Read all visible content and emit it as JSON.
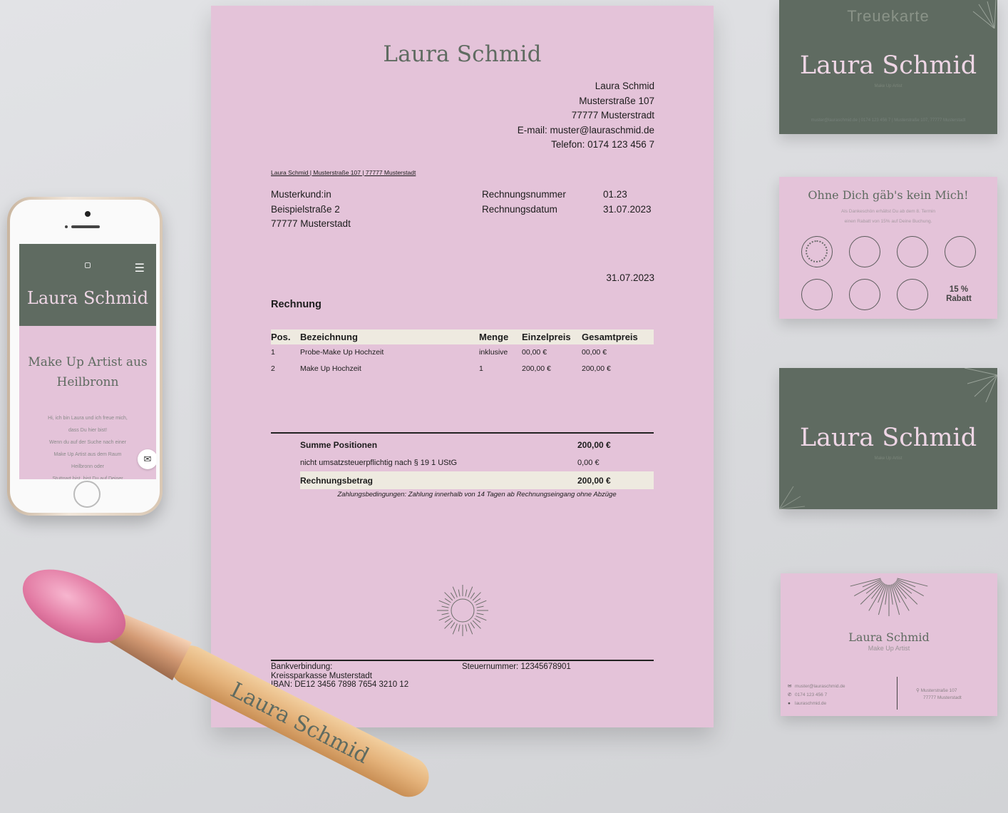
{
  "invoice": {
    "logo": "Laura Schmid",
    "sender_lines": [
      "Laura Schmid",
      "Musterstraße 107",
      "77777 Musterstradt",
      "E-mail: muster@lauraschmid.de",
      "Telefon: 0174 123 456 7"
    ],
    "return_line": "Laura Schmid | Musterstraße 107 | 77777 Musterstadt",
    "recipient_lines": [
      "Musterkund:in",
      "Beispielstraße 2",
      "77777 Musterstadt"
    ],
    "meta": [
      {
        "label": "Rechnungsnummer",
        "value": "01.23"
      },
      {
        "label": "Rechnungsdatum",
        "value": "31.07.2023"
      }
    ],
    "date": "31.07.2023",
    "heading": "Rechnung",
    "columns": [
      "Pos.",
      "Bezeichnung",
      "Menge",
      "Einzelpreis",
      "Gesamtpreis"
    ],
    "rows": [
      {
        "pos": "1",
        "bez": "Probe-Make Up Hochzeit",
        "menge": "inklusive",
        "einzel": "00,00 €",
        "gesamt": "00,00 €"
      },
      {
        "pos": "2",
        "bez": "Make Up Hochzeit",
        "menge": "1",
        "einzel": "200,00 €",
        "gesamt": "200,00 €"
      }
    ],
    "summe_label": "Summe Positionen",
    "summe_value": "200,00 €",
    "ust_label": "nicht umsatzsteuerpflichtig nach § 19 1 UStG",
    "ust_value": "0,00 €",
    "betrag_label": "Rechnungsbetrag",
    "betrag_value": "200,00 €",
    "terms": "Zahlungsbedingungen: Zahlung innerhalb von 14 Tagen ab Rechnungseingang ohne Abzüge",
    "bank_lines": [
      "Bankverbindung:",
      "Kreissparkasse Musterstadt",
      "IBAN: DE12 3456 7898 7654 3210 12"
    ],
    "tax": "Steuernummer: 12345678901"
  },
  "phone": {
    "brand": "Laura Schmid",
    "headline_lines": [
      "Make Up Artist aus",
      "Heilbronn"
    ],
    "body_lines": [
      "Hi, ich bin Laura und ich freue mich,",
      "dass Du hier bist!",
      "Wenn du auf der Suche nach einer",
      "Make Up Artist aus dem Raum",
      "Heilbronn oder",
      "Stuttgart bist, bist Du auf Deiner"
    ]
  },
  "brush": {
    "brand": "Laura Schmid"
  },
  "card_loyalty_front": {
    "title": "Treuekarte",
    "brand": "Laura Schmid",
    "tag": "Make Up Artist",
    "footer": "muster@lauraschmid.de | 0174 123 456 7 | Musterstraße 107, 77777 Musterstadt"
  },
  "card_loyalty_back": {
    "title": "Ohne Dich gäb's kein Mich!",
    "sub_lines": [
      "Als Dankeschön erhältst Du ab dem 8. Termin",
      "einen Rabatt von 15% auf Deine Buchung."
    ],
    "reward_lines": [
      "15 %",
      "Rabatt"
    ]
  },
  "card_business_front": {
    "brand": "Laura Schmid",
    "tag": "Make Up Artist"
  },
  "card_business_back": {
    "brand": "Laura Schmid",
    "role": "Make Up Artist",
    "contact_lines": [
      "muster@lauraschmid.de",
      "0174 123 456 7",
      "lauraschmid.de"
    ],
    "address_lines": [
      "Musterstraße 107",
      "77777 Musterstadt"
    ]
  },
  "colors": {
    "pink": "#e4c3d9",
    "green": "#5f6b61",
    "cream": "#eeeae0"
  }
}
